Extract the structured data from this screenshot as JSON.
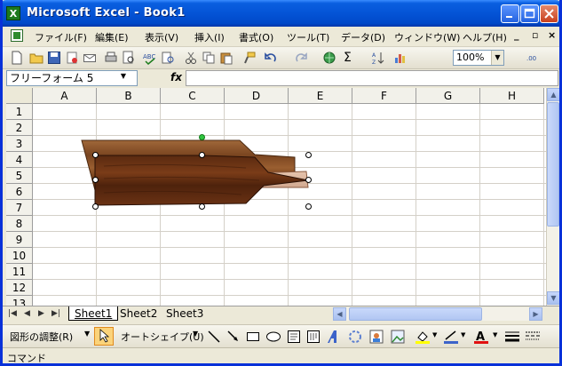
{
  "window": {
    "app_icon": "X",
    "title": "Microsoft Excel - Book1"
  },
  "menu": {
    "items": [
      "ファイル(F)",
      "編集(E)",
      "表示(V)",
      "挿入(I)",
      "書式(O)",
      "ツール(T)",
      "データ(D)",
      "ウィンドウ(W)",
      "ヘルプ(H)"
    ],
    "doc_controls": [
      "_",
      "▫",
      "×"
    ]
  },
  "toolbar": {
    "zoom": "100%",
    "sigma": "Σ"
  },
  "formula": {
    "name_box": "フリーフォーム 5",
    "fx": "fx",
    "content": ""
  },
  "grid": {
    "columns": [
      "A",
      "B",
      "C",
      "D",
      "E",
      "F",
      "G",
      "H"
    ],
    "rows": [
      "1",
      "2",
      "3",
      "4",
      "5",
      "6",
      "7",
      "8",
      "9",
      "10",
      "11",
      "12",
      "13"
    ]
  },
  "sheets": {
    "tabs": [
      "Sheet1",
      "Sheet2",
      "Sheet3"
    ],
    "active": "Sheet1"
  },
  "drawing": {
    "adjust_label": "図形の調整(R)",
    "autoshape_label": "オートシェイプ(U)"
  },
  "status": {
    "text": "コマンド"
  },
  "colors": {
    "title_blue": "#0454d6",
    "wood_dark": "#5a2a10",
    "wood_light": "#a0683a",
    "shadow_light": "#d9b8a2"
  }
}
